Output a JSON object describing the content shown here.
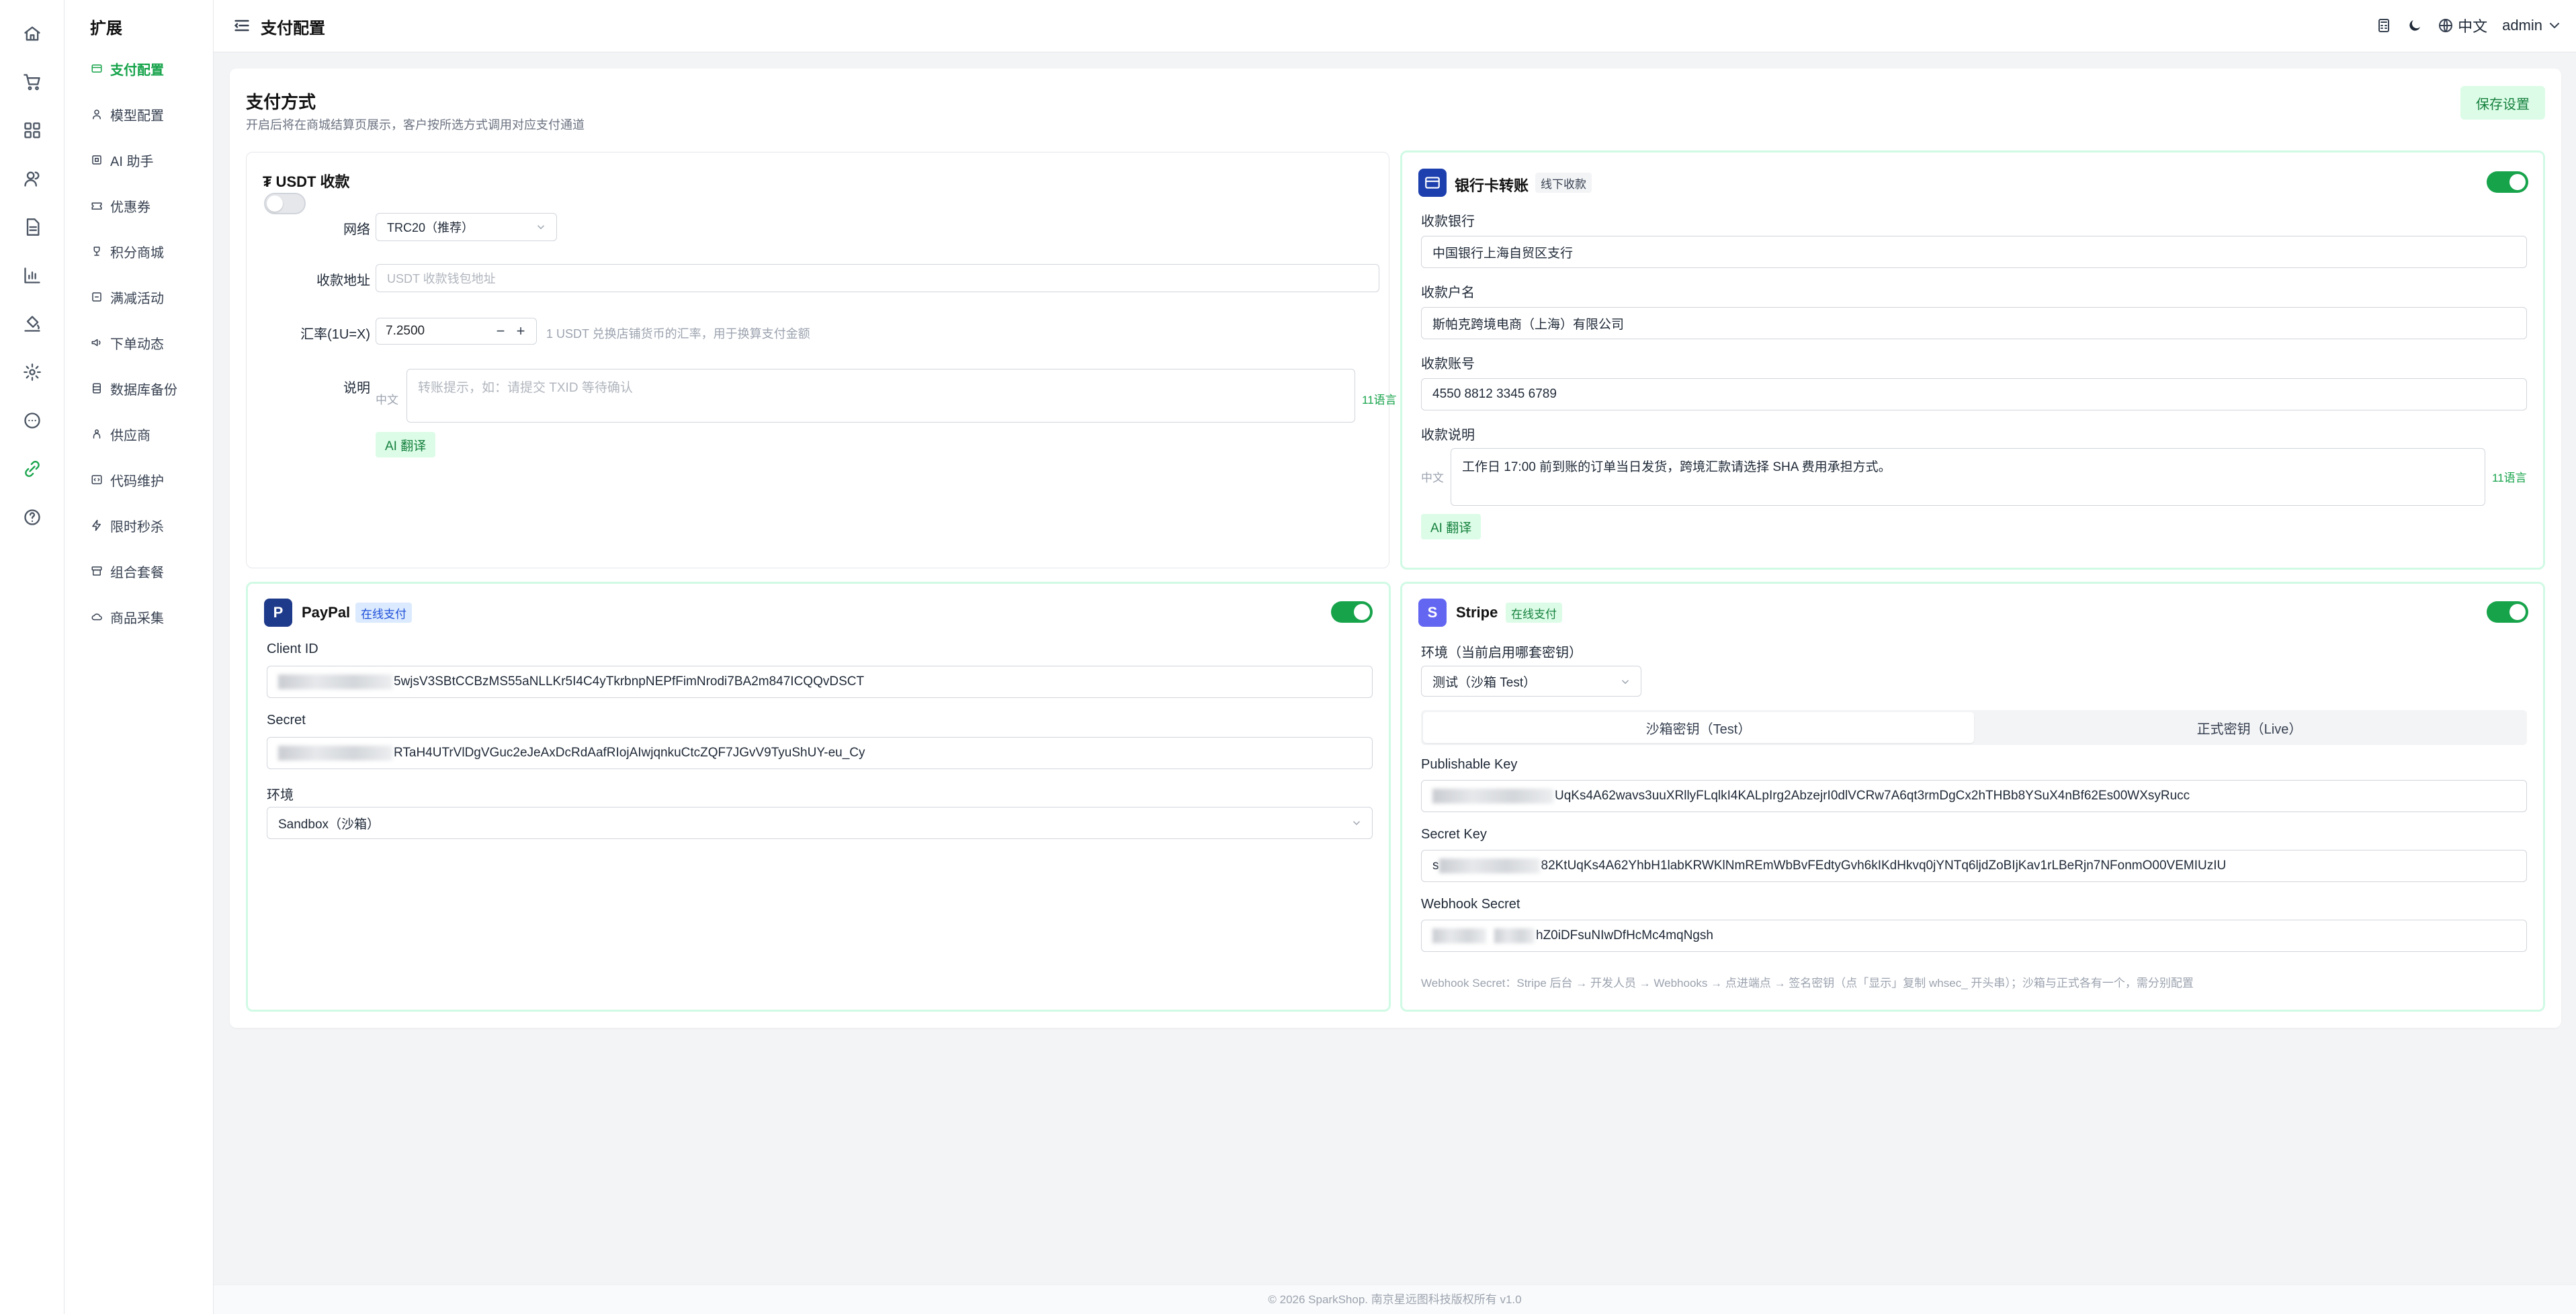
{
  "rail": {
    "icons": [
      "home-icon",
      "cart-icon",
      "grid-icon",
      "users-icon",
      "document-icon",
      "chart-icon",
      "paint-icon",
      "settings-icon",
      "message-icon",
      "extension-icon",
      "help-icon"
    ]
  },
  "sidebar": {
    "title": "扩展",
    "items": [
      {
        "label": "支付配置",
        "icon": "card-icon",
        "active": true
      },
      {
        "label": "模型配置",
        "icon": "model-icon"
      },
      {
        "label": "AI 助手",
        "icon": "ai-icon"
      },
      {
        "label": "优惠券",
        "icon": "coupon-icon"
      },
      {
        "label": "积分商城",
        "icon": "trophy-icon"
      },
      {
        "label": "满减活动",
        "icon": "discount-icon"
      },
      {
        "label": "下单动态",
        "icon": "megaphone-icon"
      },
      {
        "label": "数据库备份",
        "icon": "database-icon"
      },
      {
        "label": "供应商",
        "icon": "supplier-icon"
      },
      {
        "label": "代码维护",
        "icon": "code-icon"
      },
      {
        "label": "限时秒杀",
        "icon": "flash-icon"
      },
      {
        "label": "组合套餐",
        "icon": "bundle-icon"
      },
      {
        "label": "商品采集",
        "icon": "cloud-icon"
      }
    ]
  },
  "header": {
    "title": "支付配置",
    "language": "中文",
    "user": "admin"
  },
  "main": {
    "title": "支付方式",
    "subtitle": "开启后将在商城结算页展示，客户按所选方式调用对应支付通道",
    "save_label": "保存设置"
  },
  "usdt": {
    "title": "₮ USDT 收款",
    "enabled": false,
    "network_label": "网络",
    "network_value": "TRC20（推荐）",
    "address_label": "收款地址",
    "address_placeholder": "USDT 收款钱包地址",
    "rate_label": "汇率(1U=X)",
    "rate_value": "7.2500",
    "rate_hint": "1 USDT 兑换店铺货币的汇率，用于换算支付金额",
    "desc_label": "说明",
    "lang_tag": "中文",
    "desc_placeholder": "转账提示，如：请提交 TXID 等待确认",
    "lang_count": "11语言",
    "ai_label": "AI 翻译"
  },
  "bank": {
    "title": "银行卡转账",
    "badge": "线下收款",
    "enabled": true,
    "bank_label": "收款银行",
    "bank_value": "中国银行上海自贸区支行",
    "holder_label": "收款户名",
    "holder_value": "斯帕克跨境电商（上海）有限公司",
    "account_label": "收款账号",
    "account_value": "4550 8812 3345 6789",
    "desc_label": "收款说明",
    "lang_tag": "中文",
    "desc_value": "工作日 17:00 前到账的订单当日发货，跨境汇款请选择 SHA 费用承担方式。",
    "lang_count": "11语言",
    "ai_label": "AI 翻译"
  },
  "paypal": {
    "logo": "P",
    "title": "PayPal",
    "badge": "在线支付",
    "enabled": true,
    "client_id_label": "Client ID",
    "client_id_value": "5wjsV3SBtCCBzMS55aNLLKr5I4C4yTkrbnpNEPfFimNrodi7BA2m847ICQQvDSCT",
    "secret_label": "Secret",
    "secret_value": "RTaH4UTrVlDgVGuc2eJeAxDcRdAafRIojAIwjqnkuCtcZQF7JGvV9TyuShUY-eu_Cy",
    "env_label": "环境",
    "env_value": "Sandbox（沙箱）"
  },
  "stripe": {
    "logo": "S",
    "title": "Stripe",
    "badge": "在线支付",
    "enabled": true,
    "env_label": "环境（当前启用哪套密钥）",
    "env_value": "测试（沙箱 Test）",
    "tab_test": "沙箱密钥（Test）",
    "tab_live": "正式密钥（Live）",
    "pk_label": "Publishable Key",
    "pk_value": "UqKs4A62wavs3uuXRllyFLqlkI4KALpIrg2AbzejrI0dlVCRw7A6qt3rmDgCx2hTHBb8YSuX4nBf62Es00WXsyRucc",
    "sk_label": "Secret Key",
    "sk_prefix": "s",
    "sk_value": "82KtUqKs4A62YhbH1labKRWKlNmREmWbBvFEdtyGvh6kIKdHkvq0jYNTq6ljdZoBIjKav1rLBeRjn7NFonmO00VEMIUzIU",
    "wh_label": "Webhook Secret",
    "wh_value": "hZ0iDFsuNIwDfHcMc4mqNgsh",
    "hint": "Webhook Secret：Stripe 后台 → 开发人员 → Webhooks → 点进端点 → 签名密钥（点「显示」复制 whsec_ 开头串）；沙箱与正式各有一个，需分别配置"
  },
  "footer": {
    "text": "© 2026 SparkShop. 南京星远图科技版权所有    v1.0"
  },
  "colors": {
    "accent": "#16a34a",
    "paypal": "#1e3a8a",
    "stripe": "#6366f1",
    "bank": "#1e40af"
  }
}
